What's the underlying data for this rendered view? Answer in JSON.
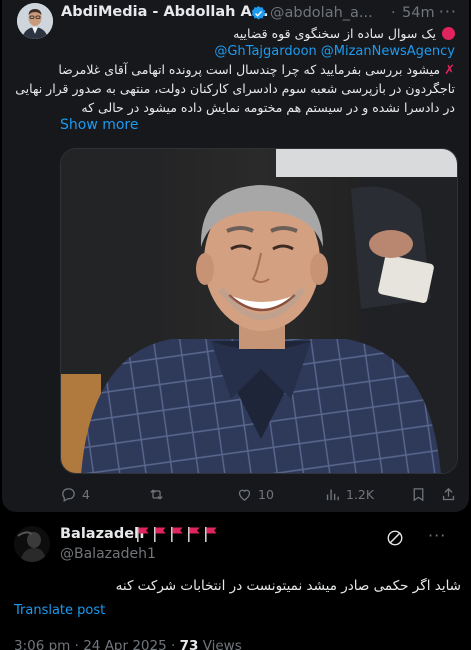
{
  "quoted": {
    "display_name": "AbdiMedia - Abdollah A...",
    "handle": "@abdolah_a...",
    "separator": "·",
    "time_ago": "54m",
    "more": "···",
    "line1": "یک سوال ساده از سخنگوی قوه قضاییه",
    "mentions": [
      "@GhTajgardoon",
      "@MizanNewsAgency"
    ],
    "line3": "میشود بررسی بفرمایید که چرا چندسال است پرونده اتهامی آقای غلامرضا",
    "line4": "تاجگردون در بازپرسی شعبه سوم دادسرای کارکنان دولت، منتهی به صدور قرار نهایی",
    "line5": "در دادسرا نشده و در سیستم هم مختومه نمایش داده میشود در حالی که",
    "show_more": "Show more",
    "stats": {
      "replies": "4",
      "reposts": "",
      "likes": "10",
      "views": "1.2K"
    }
  },
  "reply": {
    "display_name": "Balazadeh",
    "flag_count": 5,
    "handle": "@Balazadeh1",
    "text": "شاید اگر حکمی صادر میشد نمیتونست در انتخابات شرکت کنه",
    "translate": "Translate post",
    "time": "3:06 pm",
    "date": "24 Apr 2025",
    "separator": "·",
    "views_count": "73",
    "views_label": "Views"
  },
  "colors": {
    "background": "#000000",
    "card": "#16181c",
    "link": "#1d9bf0",
    "muted": "#71767b",
    "flag_red": "#e0245e"
  },
  "icons": [
    "verified-badge-icon",
    "more-icon",
    "red-circle-icon",
    "warning-icon",
    "reply-icon",
    "repost-icon",
    "like-icon",
    "views-icon",
    "bookmark-icon",
    "share-icon",
    "grok-icon",
    "red-flag-icon"
  ]
}
